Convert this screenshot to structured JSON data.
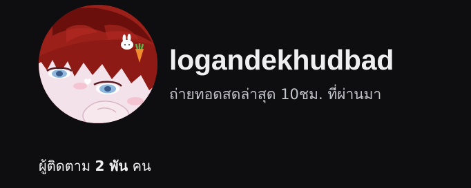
{
  "profile": {
    "username": "logandekhudbad",
    "last_live": "ถ่ายทอดสดล่าสุด 10ชม. ที่ผ่านมา",
    "avatar_icon": "anime-avatar-image",
    "followers": {
      "prefix": "ผู้ติดตาม",
      "count": "2 พัน",
      "suffix": "คน"
    }
  },
  "colors": {
    "background": "#0e0e10",
    "primary_text": "#efeff1",
    "secondary_text": "#c4c4cc",
    "avatar_hair": "#8e1a15"
  }
}
